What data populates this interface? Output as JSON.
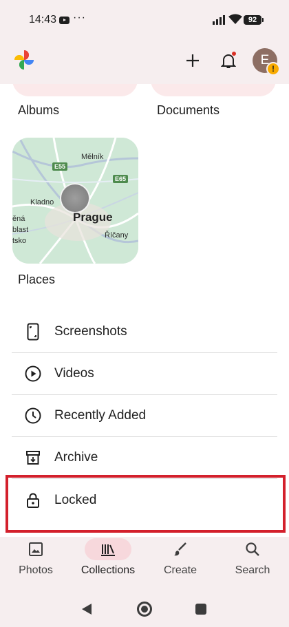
{
  "status_bar": {
    "time": "14:43",
    "notification_more": "···",
    "battery": "92"
  },
  "app_bar": {
    "avatar_initial": "E",
    "warning_glyph": "!"
  },
  "collections": {
    "albums_label": "Albums",
    "documents_label": "Documents",
    "places_label": "Places",
    "map": {
      "city": "Prague",
      "towns": [
        "Mělník",
        "Kladno",
        "Říčany"
      ],
      "region_lines": [
        "ěná",
        "blast",
        "tsko"
      ],
      "roads": [
        "E55",
        "E65"
      ]
    }
  },
  "list": {
    "screenshots": "Screenshots",
    "videos": "Videos",
    "recently_added": "Recently Added",
    "archive": "Archive",
    "locked": "Locked"
  },
  "bottom_nav": {
    "photos": "Photos",
    "collections": "Collections",
    "create": "Create",
    "search": "Search",
    "active": "collections"
  },
  "colors": {
    "surface": "#f6eeef",
    "active_pill": "#f7d8dc",
    "highlight_border": "#d3202c",
    "map_green": "#cfe8d6"
  }
}
